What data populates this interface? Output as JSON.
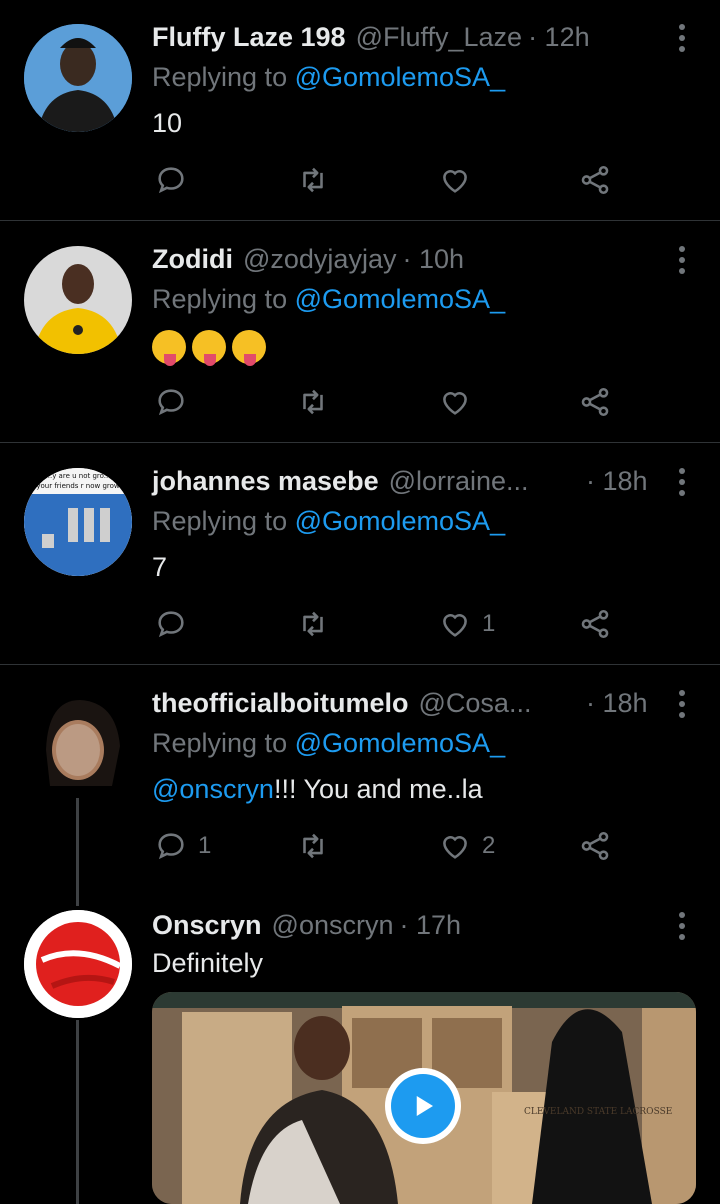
{
  "tweets": [
    {
      "name": "Fluffy Laze 198",
      "handle": "@Fluffy_Laze",
      "time": "· 12h",
      "replying_prefix": "Replying to ",
      "replying_to": "@GomolemoSA_",
      "text": "10",
      "replies": "",
      "retweets": "",
      "likes": ""
    },
    {
      "name": "Zodidi",
      "handle": "@zodyjayjay",
      "time": "· 10h",
      "replying_prefix": "Replying to ",
      "replying_to": "@GomolemoSA_",
      "text": "",
      "emoji_name": "face-savoring-food",
      "replies": "",
      "retweets": "",
      "likes": ""
    },
    {
      "name": "johannes masebe",
      "handle": "@lorraine...",
      "time": "· 18h",
      "replying_prefix": "Replying to ",
      "replying_to": "@GomolemoSA_",
      "text": "7",
      "avatar_text_1": "...y are u not gro...",
      "avatar_text_2": "your friends r now grow",
      "replies": "",
      "retweets": "",
      "likes": "1"
    },
    {
      "name": "theofficialboitumelo",
      "handle": "@Cosa...",
      "time": "· 18h",
      "replying_prefix": "Replying to ",
      "replying_to": "@GomolemoSA_",
      "mention": "@onscryn",
      "text": "!!! You and me..la",
      "replies": "1",
      "retweets": "",
      "likes": "2"
    },
    {
      "name": "Onscryn",
      "handle": "@onscryn",
      "time": "· 17h",
      "text": "Definitely",
      "video_caption": "CLEVELAND STATE LACROSSE"
    }
  ],
  "colors": {
    "background": "#000000",
    "text": "#e7e9ea",
    "muted": "#71767b",
    "link": "#1d9bf0",
    "divider": "#2f3336"
  },
  "icons": [
    "reply-icon",
    "retweet-icon",
    "like-icon",
    "share-icon",
    "more-icon",
    "play-icon"
  ]
}
